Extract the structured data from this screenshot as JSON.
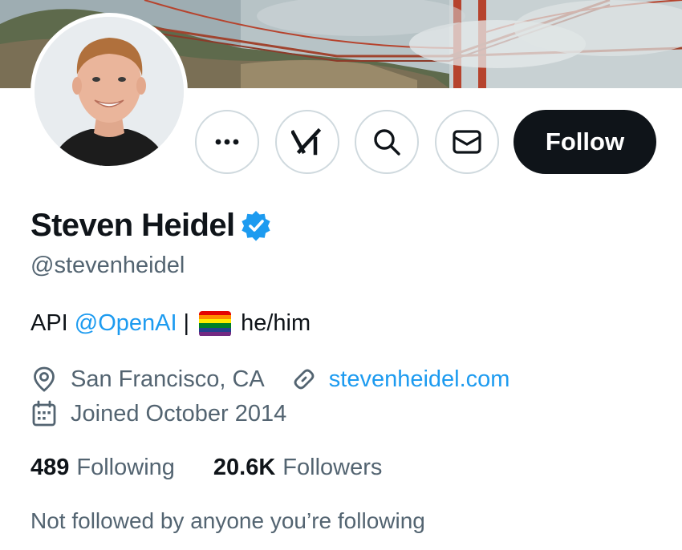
{
  "profile": {
    "display_name": "Steven Heidel",
    "handle": "@stevenheidel",
    "verified": true,
    "bio": {
      "prefix": "API",
      "mention": "@OpenAI",
      "separator": "|",
      "emoji": "rainbow-flag",
      "suffix": "he/him"
    },
    "location": "San Francisco, CA",
    "website": "stevenheidel.com",
    "joined": "Joined October 2014",
    "following_count": "489",
    "following_label": "Following",
    "followers_count": "20.6K",
    "followers_label": "Followers",
    "followed_by_text": "Not followed by anyone you’re following"
  },
  "actions": {
    "more_icon": "more-horizontal-icon",
    "grok_icon": "grok-icon",
    "search_icon": "search-icon",
    "message_icon": "envelope-icon",
    "follow_label": "Follow"
  },
  "colors": {
    "accent": "#1d9bf0",
    "text_primary": "#0f1419",
    "text_secondary": "#536471",
    "follow_bg": "#0f1419",
    "button_border": "#cfd9de"
  },
  "rainbow_colors": [
    "#e40303",
    "#ff8c00",
    "#ffed00",
    "#008026",
    "#24408e",
    "#732982"
  ]
}
